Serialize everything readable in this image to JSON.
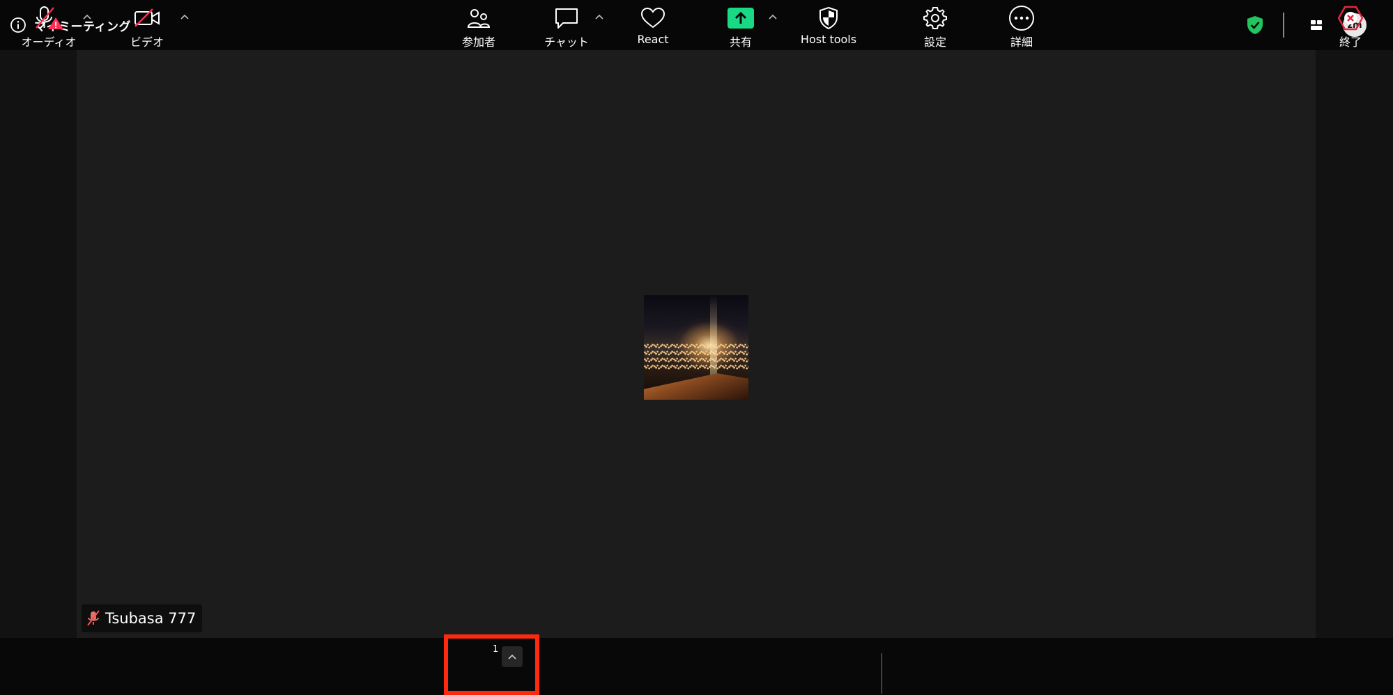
{
  "meeting": {
    "title": "マイミーティング"
  },
  "participant": {
    "name": "Tsubasa 777"
  },
  "toolbar": {
    "audio_label": "オーディオ",
    "video_label": "ビデオ",
    "participants_label": "参加者",
    "participants_count": "1",
    "chat_label": "チャット",
    "react_label": "React",
    "share_label": "共有",
    "host_tools_label": "Host tools",
    "settings_label": "設定",
    "more_label": "詳細",
    "end_label": "終了"
  },
  "top": {
    "avatar_text": "zm"
  },
  "colors": {
    "accent_green": "#22c55e",
    "highlight_red": "#ff2a0e",
    "end_red": "#e5263f",
    "warning_red": "#ff2d55"
  },
  "icons": [
    "info-icon",
    "shield-check-icon",
    "grid-icon",
    "mic-muted-icon",
    "warning-icon",
    "video-off-icon",
    "participants-icon",
    "chat-icon",
    "heart-icon",
    "share-arrow-icon",
    "host-tools-shield-icon",
    "gear-icon",
    "more-dots-icon",
    "end-x-icon",
    "chevron-up-icon"
  ]
}
